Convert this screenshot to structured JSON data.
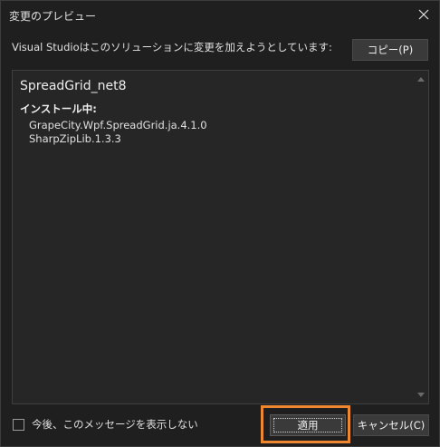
{
  "window": {
    "title": "変更のプレビュー",
    "close_icon": "close-icon"
  },
  "description": "Visual Studioはこのソリューションに変更を加えようとしています:",
  "copy_button": "コピー(P)",
  "preview": {
    "project_name": "SpreadGrid_net8",
    "section_header": "インストール中:",
    "packages": [
      "GrapeCity.Wpf.SpreadGrid.ja.4.1.0",
      "SharpZipLib.1.3.3"
    ]
  },
  "footer": {
    "dont_show_label": "今後、このメッセージを表示しない",
    "dont_show_checked": false,
    "apply_button": "適用",
    "cancel_button": "キャンセル(C)"
  },
  "colors": {
    "background": "#1f1f1f",
    "highlight": "#ee8730"
  }
}
